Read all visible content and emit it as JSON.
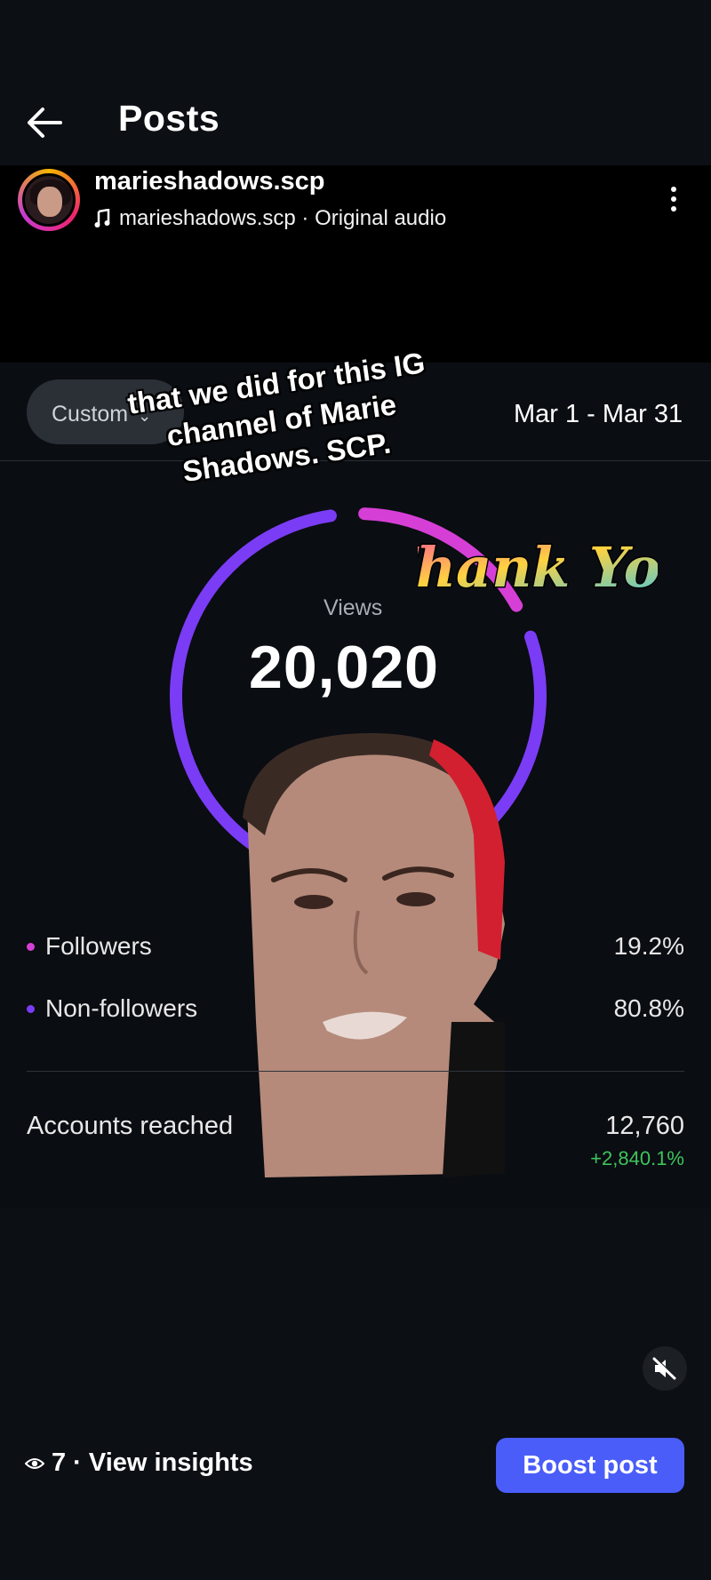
{
  "header": {
    "title": "Posts"
  },
  "post": {
    "username": "marieshadows.scp",
    "audio": "marieshadows.scp · Original audio"
  },
  "media": {
    "filter_label": "Custom",
    "date_range": "Mar 1 - Mar 31",
    "caption": "that we did for this IG channel of Marie Shadows. SCP.",
    "sticker_text": "Thank You",
    "views_label": "Views",
    "views_value": "20,020",
    "breakdown": [
      {
        "label": "Followers",
        "value": "19.2%",
        "share": 0.192,
        "color": "#d63fd6"
      },
      {
        "label": "Non-followers",
        "value": "80.8%",
        "share": 0.808,
        "color": "#7b3cf5"
      }
    ],
    "reach_label": "Accounts reached",
    "reach_value": "12,760",
    "reach_delta": "+2,840.1%"
  },
  "footer": {
    "views_count": "7 · View insights",
    "boost_label": "Boost post"
  },
  "colors": {
    "accent": "#4a5df9",
    "followers": "#d63fd6",
    "non_followers": "#7b3cf5",
    "positive": "#3ec45b"
  }
}
